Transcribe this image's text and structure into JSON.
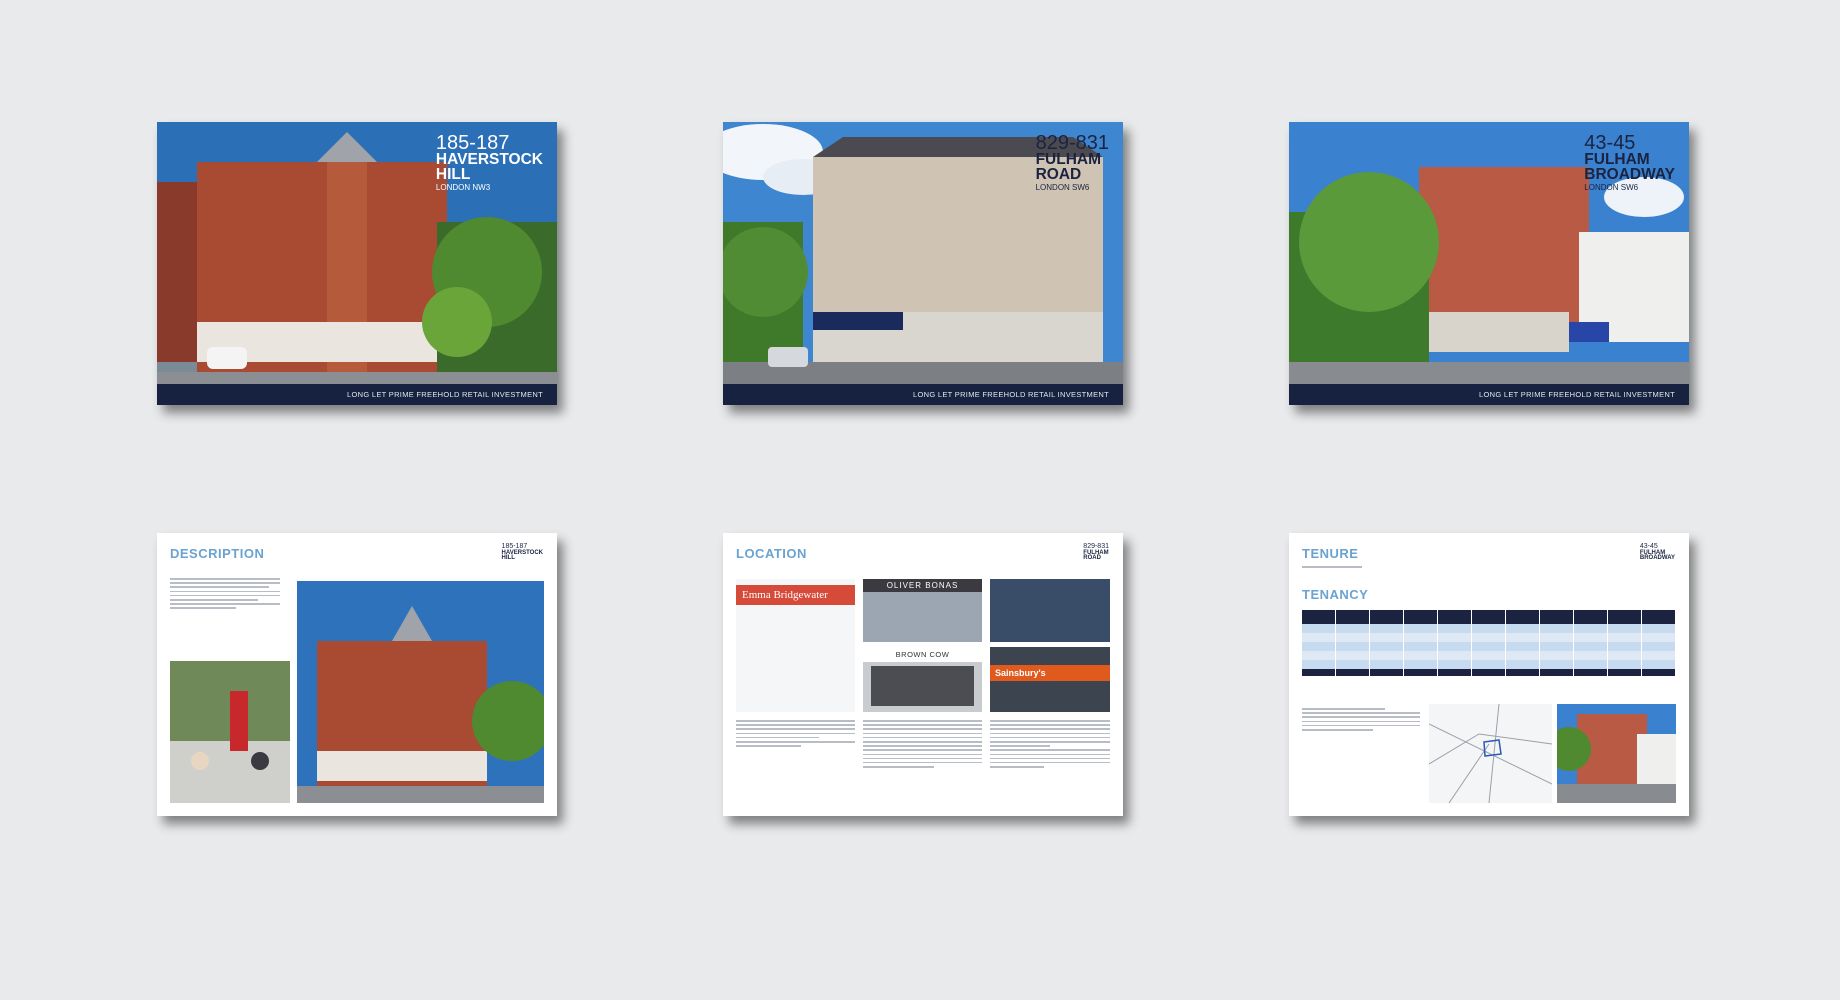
{
  "cover_tagline": "LONG LET PRIME FREEHOLD RETAIL INVESTMENT",
  "properties": [
    {
      "number": "185-187",
      "name_lines": [
        "HAVERSTOCK",
        "HILL"
      ],
      "location": "LONDON NW3"
    },
    {
      "number": "829-831",
      "name_lines": [
        "FULHAM",
        "ROAD"
      ],
      "location": "LONDON SW6"
    },
    {
      "number": "43-45",
      "name_lines": [
        "FULHAM",
        "BROADWAY"
      ],
      "location": "LONDON SW6"
    }
  ],
  "pages": {
    "description": {
      "title": "DESCRIPTION"
    },
    "location": {
      "title": "LOCATION",
      "shop_signs": [
        "Emma Bridgewater",
        "OLIVER BONAS",
        "BROWN COW",
        "Sainsbury's"
      ]
    },
    "tenure": {
      "title": "TENURE",
      "subtitle": "TENANCY"
    }
  },
  "colors": {
    "navy": "#16223f",
    "accent_blue": "#6aa2d0",
    "background": "#e9eaec"
  }
}
